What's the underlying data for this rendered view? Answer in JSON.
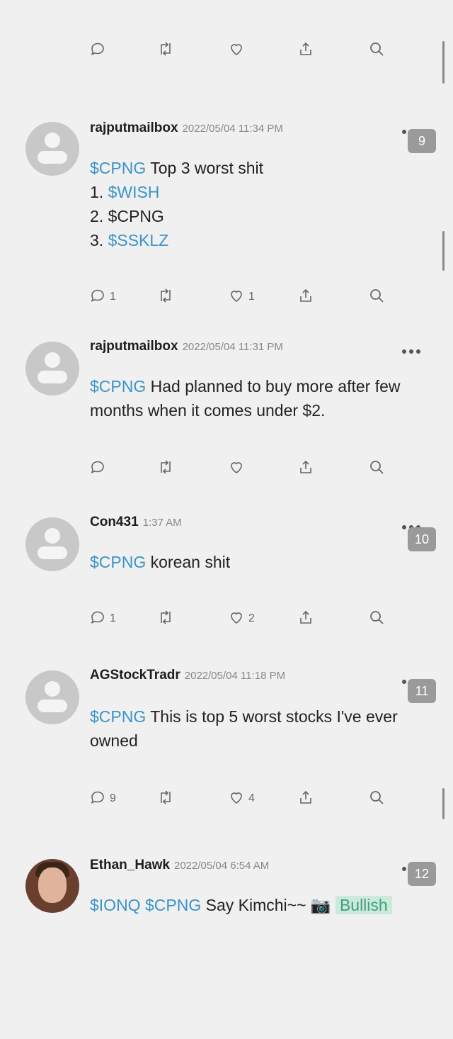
{
  "posts": [
    {
      "username": "rajputmailbox",
      "time": "2022/05/04 11:34 PM",
      "badge": "9",
      "lines": [
        [
          {
            "t": "$CPNG",
            "c": "cash"
          },
          {
            "t": " Top 3 worst shit",
            "c": ""
          }
        ],
        [
          {
            "t": "1. ",
            "c": ""
          },
          {
            "t": "$WISH",
            "c": "cash"
          }
        ],
        [
          {
            "t": "2. $CPNG",
            "c": ""
          }
        ],
        [
          {
            "t": "3. ",
            "c": ""
          },
          {
            "t": "$SSKLZ",
            "c": "cash"
          }
        ]
      ],
      "comments": "1",
      "likes": "1"
    },
    {
      "username": "rajputmailbox",
      "time": "2022/05/04 11:31 PM",
      "badge": "",
      "lines": [
        [
          {
            "t": "$CPNG",
            "c": "cash"
          },
          {
            "t": " Had planned to buy more after few",
            "c": ""
          }
        ],
        [
          {
            "t": "months when it comes under $2.",
            "c": ""
          }
        ]
      ],
      "comments": "",
      "likes": ""
    },
    {
      "username": "Con431",
      "time": "1:37 AM",
      "badge": "10",
      "lines": [
        [
          {
            "t": "$CPNG",
            "c": "cash"
          },
          {
            "t": " korean shit",
            "c": ""
          }
        ]
      ],
      "comments": "1",
      "likes": "2"
    },
    {
      "username": "AGStockTradr",
      "time": "2022/05/04 11:18 PM",
      "badge": "11",
      "lines": [
        [
          {
            "t": "$CPNG",
            "c": "cash"
          },
          {
            "t": " This is top 5 worst stocks I've ever",
            "c": ""
          }
        ],
        [
          {
            "t": "owned",
            "c": ""
          }
        ]
      ],
      "comments": "9",
      "likes": "4"
    },
    {
      "username": "Ethan_Hawk",
      "time": "2022/05/04 6:54 AM",
      "badge": "12",
      "lines": [
        [
          {
            "t": "$IONQ $CPNG",
            "c": "cash"
          },
          {
            "t": " Say Kimchi~~ 📷 ",
            "c": ""
          },
          {
            "t": "Bullish",
            "c": "bullish"
          }
        ]
      ],
      "comments": "",
      "likes": ""
    }
  ],
  "icons": {
    "comment": "comment-icon",
    "repost": "repost-icon",
    "like": "heart-icon",
    "share": "share-icon",
    "search": "search-icon"
  }
}
